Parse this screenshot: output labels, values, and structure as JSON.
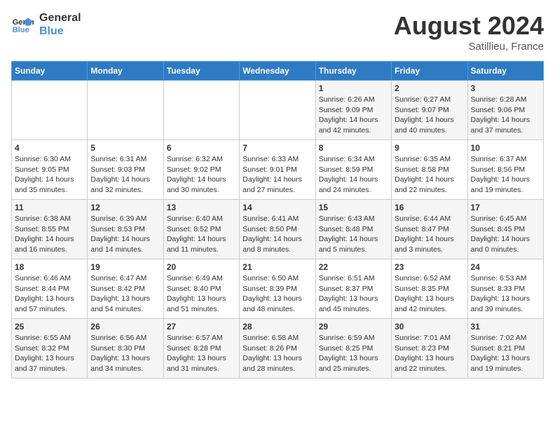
{
  "logo": {
    "line1": "General",
    "line2": "Blue"
  },
  "title": {
    "month_year": "August 2024",
    "location": "Satillieu, France"
  },
  "days_of_week": [
    "Sunday",
    "Monday",
    "Tuesday",
    "Wednesday",
    "Thursday",
    "Friday",
    "Saturday"
  ],
  "weeks": [
    [
      {
        "day": "",
        "info": ""
      },
      {
        "day": "",
        "info": ""
      },
      {
        "day": "",
        "info": ""
      },
      {
        "day": "",
        "info": ""
      },
      {
        "day": "1",
        "info": "Sunrise: 6:26 AM\nSunset: 9:09 PM\nDaylight: 14 hours\nand 42 minutes."
      },
      {
        "day": "2",
        "info": "Sunrise: 6:27 AM\nSunset: 9:07 PM\nDaylight: 14 hours\nand 40 minutes."
      },
      {
        "day": "3",
        "info": "Sunrise: 6:28 AM\nSunset: 9:06 PM\nDaylight: 14 hours\nand 37 minutes."
      }
    ],
    [
      {
        "day": "4",
        "info": "Sunrise: 6:30 AM\nSunset: 9:05 PM\nDaylight: 14 hours\nand 35 minutes."
      },
      {
        "day": "5",
        "info": "Sunrise: 6:31 AM\nSunset: 9:03 PM\nDaylight: 14 hours\nand 32 minutes."
      },
      {
        "day": "6",
        "info": "Sunrise: 6:32 AM\nSunset: 9:02 PM\nDaylight: 14 hours\nand 30 minutes."
      },
      {
        "day": "7",
        "info": "Sunrise: 6:33 AM\nSunset: 9:01 PM\nDaylight: 14 hours\nand 27 minutes."
      },
      {
        "day": "8",
        "info": "Sunrise: 6:34 AM\nSunset: 8:59 PM\nDaylight: 14 hours\nand 24 minutes."
      },
      {
        "day": "9",
        "info": "Sunrise: 6:35 AM\nSunset: 8:58 PM\nDaylight: 14 hours\nand 22 minutes."
      },
      {
        "day": "10",
        "info": "Sunrise: 6:37 AM\nSunset: 8:56 PM\nDaylight: 14 hours\nand 19 minutes."
      }
    ],
    [
      {
        "day": "11",
        "info": "Sunrise: 6:38 AM\nSunset: 8:55 PM\nDaylight: 14 hours\nand 16 minutes."
      },
      {
        "day": "12",
        "info": "Sunrise: 6:39 AM\nSunset: 8:53 PM\nDaylight: 14 hours\nand 14 minutes."
      },
      {
        "day": "13",
        "info": "Sunrise: 6:40 AM\nSunset: 8:52 PM\nDaylight: 14 hours\nand 11 minutes."
      },
      {
        "day": "14",
        "info": "Sunrise: 6:41 AM\nSunset: 8:50 PM\nDaylight: 14 hours\nand 8 minutes."
      },
      {
        "day": "15",
        "info": "Sunrise: 6:43 AM\nSunset: 8:48 PM\nDaylight: 14 hours\nand 5 minutes."
      },
      {
        "day": "16",
        "info": "Sunrise: 6:44 AM\nSunset: 8:47 PM\nDaylight: 14 hours\nand 3 minutes."
      },
      {
        "day": "17",
        "info": "Sunrise: 6:45 AM\nSunset: 8:45 PM\nDaylight: 14 hours\nand 0 minutes."
      }
    ],
    [
      {
        "day": "18",
        "info": "Sunrise: 6:46 AM\nSunset: 8:44 PM\nDaylight: 13 hours\nand 57 minutes."
      },
      {
        "day": "19",
        "info": "Sunrise: 6:47 AM\nSunset: 8:42 PM\nDaylight: 13 hours\nand 54 minutes."
      },
      {
        "day": "20",
        "info": "Sunrise: 6:49 AM\nSunset: 8:40 PM\nDaylight: 13 hours\nand 51 minutes."
      },
      {
        "day": "21",
        "info": "Sunrise: 6:50 AM\nSunset: 8:39 PM\nDaylight: 13 hours\nand 48 minutes."
      },
      {
        "day": "22",
        "info": "Sunrise: 6:51 AM\nSunset: 8:37 PM\nDaylight: 13 hours\nand 45 minutes."
      },
      {
        "day": "23",
        "info": "Sunrise: 6:52 AM\nSunset: 8:35 PM\nDaylight: 13 hours\nand 42 minutes."
      },
      {
        "day": "24",
        "info": "Sunrise: 6:53 AM\nSunset: 8:33 PM\nDaylight: 13 hours\nand 39 minutes."
      }
    ],
    [
      {
        "day": "25",
        "info": "Sunrise: 6:55 AM\nSunset: 8:32 PM\nDaylight: 13 hours\nand 37 minutes."
      },
      {
        "day": "26",
        "info": "Sunrise: 6:56 AM\nSunset: 8:30 PM\nDaylight: 13 hours\nand 34 minutes."
      },
      {
        "day": "27",
        "info": "Sunrise: 6:57 AM\nSunset: 8:28 PM\nDaylight: 13 hours\nand 31 minutes."
      },
      {
        "day": "28",
        "info": "Sunrise: 6:58 AM\nSunset: 8:26 PM\nDaylight: 13 hours\nand 28 minutes."
      },
      {
        "day": "29",
        "info": "Sunrise: 6:59 AM\nSunset: 8:25 PM\nDaylight: 13 hours\nand 25 minutes."
      },
      {
        "day": "30",
        "info": "Sunrise: 7:01 AM\nSunset: 8:23 PM\nDaylight: 13 hours\nand 22 minutes."
      },
      {
        "day": "31",
        "info": "Sunrise: 7:02 AM\nSunset: 8:21 PM\nDaylight: 13 hours\nand 19 minutes."
      }
    ]
  ]
}
